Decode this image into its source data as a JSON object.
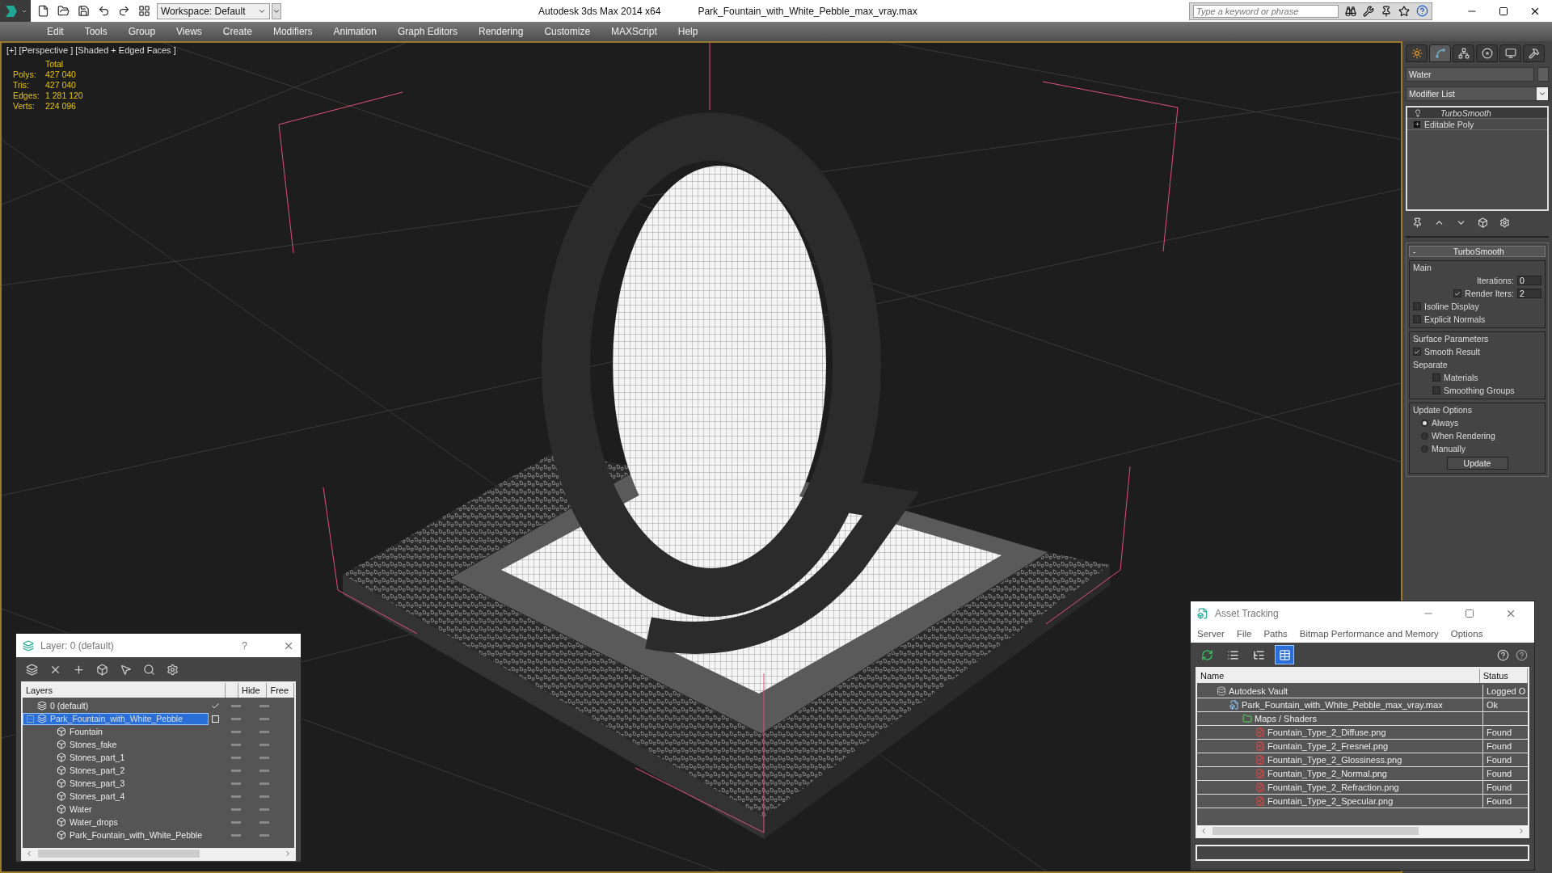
{
  "title_bar": {
    "workspace": "Workspace: Default",
    "app_title": "Autodesk 3ds Max  2014 x64",
    "file_name": "Park_Fountain_with_White_Pebble_max_vray.max",
    "search": {
      "placeholder": "Type a keyword or phrase"
    }
  },
  "menu": [
    "Edit",
    "Tools",
    "Group",
    "Views",
    "Create",
    "Modifiers",
    "Animation",
    "Graph Editors",
    "Rendering",
    "Customize",
    "MAXScript",
    "Help"
  ],
  "viewport": {
    "label": "[+] [Perspective ] [Shaded + Edged Faces ]",
    "stats": {
      "header": "Total",
      "rows": [
        {
          "label": "Polys:",
          "value": "427 040"
        },
        {
          "label": "Tris:",
          "value": "427 040"
        },
        {
          "label": "Edges:",
          "value": "1 281 120"
        },
        {
          "label": "Verts:",
          "value": "224 096"
        }
      ]
    }
  },
  "command_panel": {
    "tabs": [
      {
        "kind": "create",
        "selected": false
      },
      {
        "kind": "modify",
        "selected": true
      },
      {
        "kind": "hierarchy",
        "selected": false
      },
      {
        "kind": "motion",
        "selected": false
      },
      {
        "kind": "display",
        "selected": false
      },
      {
        "kind": "utilities",
        "selected": false
      }
    ],
    "object_name": "Water",
    "modifier_list": "Modifier List",
    "stack": [
      {
        "kind": "modifier",
        "label": "TurboSmooth",
        "selected": true
      },
      {
        "kind": "base",
        "label": "Editable Poly",
        "selected": false
      }
    ],
    "rollout": {
      "collapse": "-",
      "title": "TurboSmooth",
      "main": {
        "title": "Main",
        "iterations": {
          "label": "Iterations:",
          "value": "0"
        },
        "render_iters": {
          "label": "Render Iters:",
          "value": "2",
          "checked": true
        },
        "checks": [
          {
            "label": "Isoline Display",
            "checked": false
          },
          {
            "label": "Explicit Normals",
            "checked": false
          }
        ]
      },
      "surface": {
        "title": "Surface Parameters",
        "smooth_result": {
          "label": "Smooth Result",
          "checked": true
        },
        "separate": "Separate",
        "options": [
          {
            "label": "Materials",
            "checked": false
          },
          {
            "label": "Smoothing Groups",
            "checked": false
          }
        ]
      },
      "update": {
        "title": "Update Options",
        "options": [
          {
            "label": "Always",
            "selected": true
          },
          {
            "label": "When Rendering",
            "selected": false
          },
          {
            "label": "Manually",
            "selected": false
          }
        ],
        "button": "Update"
      }
    }
  },
  "layer_dialog": {
    "title": "Layer: 0 (default)",
    "help": "?",
    "columns": [
      "Layers",
      "Hide",
      "Free"
    ],
    "layers": [
      {
        "name": "0 (default)",
        "current": true,
        "selected": false
      },
      {
        "name": "Park_Fountain_with_White_Pebble",
        "current": false,
        "selected": true,
        "expanded": true,
        "children": [
          {
            "name": "Fountain",
            "selected": false
          },
          {
            "name": "Stones_fake",
            "selected": false
          },
          {
            "name": "Stones_part_1",
            "selected": false
          },
          {
            "name": "Stones_part_2",
            "selected": false
          },
          {
            "name": "Stones_part_3",
            "selected": false
          },
          {
            "name": "Stones_part_4",
            "selected": false
          },
          {
            "name": "Water",
            "selected": false
          },
          {
            "name": "Water_drops",
            "selected": false
          },
          {
            "name": "Park_Fountain_with_White_Pebble",
            "selected": false
          }
        ]
      }
    ]
  },
  "asset_tracking": {
    "title": "Asset Tracking",
    "menu": [
      "Server",
      "File",
      "Paths",
      "Bitmap Performance and Memory",
      "Options"
    ],
    "toolbar": [
      {
        "kind": "refresh",
        "selected": false
      },
      {
        "kind": "list",
        "selected": false
      },
      {
        "kind": "tree",
        "selected": false
      },
      {
        "kind": "table",
        "selected": true
      }
    ],
    "columns": [
      "Name",
      "Status"
    ],
    "assets": [
      {
        "kind": "vault",
        "name": "Autodesk Vault",
        "status": "Logged O",
        "children": [
          {
            "kind": "max",
            "name": "Park_Fountain_with_White_Pebble_max_vray.max",
            "status": "Ok",
            "children": [
              {
                "kind": "folder",
                "name": "Maps / Shaders",
                "children": [
                  {
                    "kind": "png",
                    "name": "Fountain_Type_2_Diffuse.png",
                    "status": "Found"
                  },
                  {
                    "kind": "png",
                    "name": "Fountain_Type_2_Fresnel.png",
                    "status": "Found"
                  },
                  {
                    "kind": "png",
                    "name": "Fountain_Type_2_Glossiness.png",
                    "status": "Found"
                  },
                  {
                    "kind": "png",
                    "name": "Fountain_Type_2_Normal.png",
                    "status": "Found"
                  },
                  {
                    "kind": "png",
                    "name": "Fountain_Type_2_Refraction.png",
                    "status": "Found"
                  },
                  {
                    "kind": "png",
                    "name": "Fountain_Type_2_Specular.png",
                    "status": "Found"
                  }
                ]
              }
            ]
          }
        ]
      }
    ]
  }
}
